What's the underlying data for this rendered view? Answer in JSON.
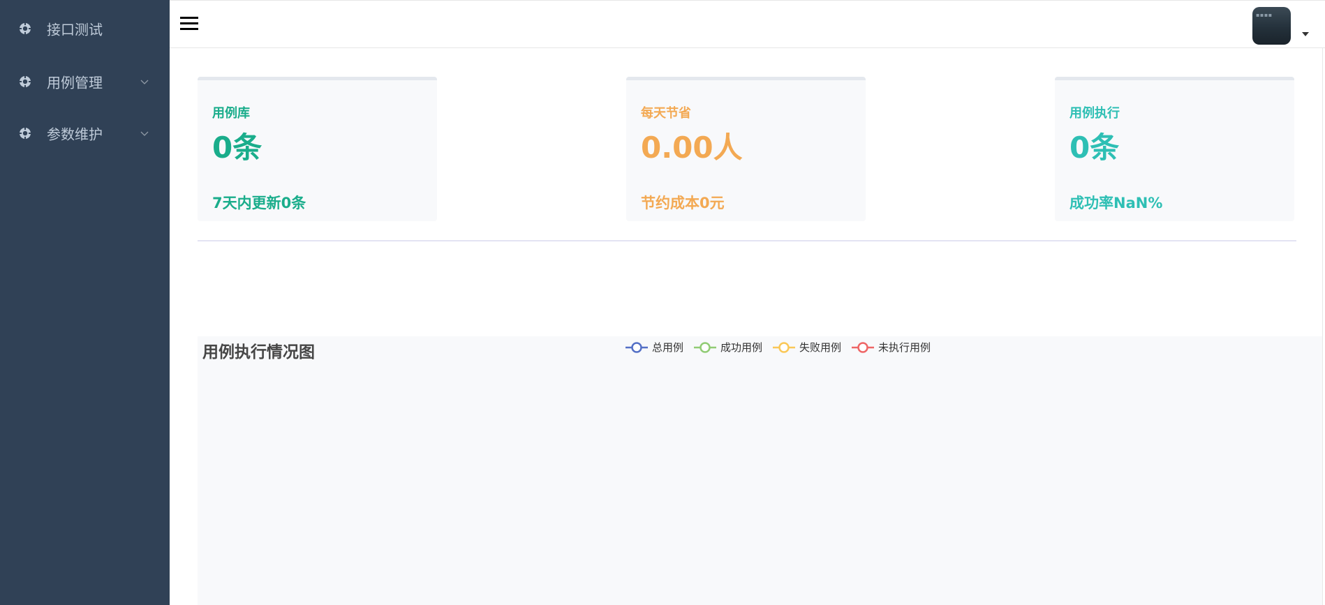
{
  "sidebar": {
    "items": [
      {
        "label": "接口测试",
        "icon": "gear-icon",
        "expandable": false
      },
      {
        "label": "用例管理",
        "icon": "gear-icon",
        "expandable": true
      },
      {
        "label": "参数维护",
        "icon": "gear-icon",
        "expandable": true
      }
    ]
  },
  "header": {
    "menu_icon": "hamburger-menu-icon",
    "avatar_icon": "user-avatar",
    "avatar_caret": "caret-down-icon"
  },
  "cards": [
    {
      "title": "用例库",
      "value": "0条",
      "footer": "7天内更新0条",
      "color": "#1aad8b"
    },
    {
      "title": "每天节省",
      "value": "0.00人",
      "footer": "节约成本0元",
      "color": "#f3a953"
    },
    {
      "title": "用例执行",
      "value": "0条",
      "footer": "成功率NaN%",
      "color": "#2ebfb4"
    }
  ],
  "chart_data": {
    "type": "line",
    "title": "用例执行情况图",
    "series": [
      {
        "name": "总用例",
        "values": []
      },
      {
        "name": "成功用例",
        "values": []
      },
      {
        "name": "失败用例",
        "values": []
      },
      {
        "name": "未执行用例",
        "values": []
      }
    ],
    "colors": [
      "#5470c6",
      "#91cc75",
      "#fac858",
      "#ee6666"
    ],
    "legend_position": "top-center"
  }
}
